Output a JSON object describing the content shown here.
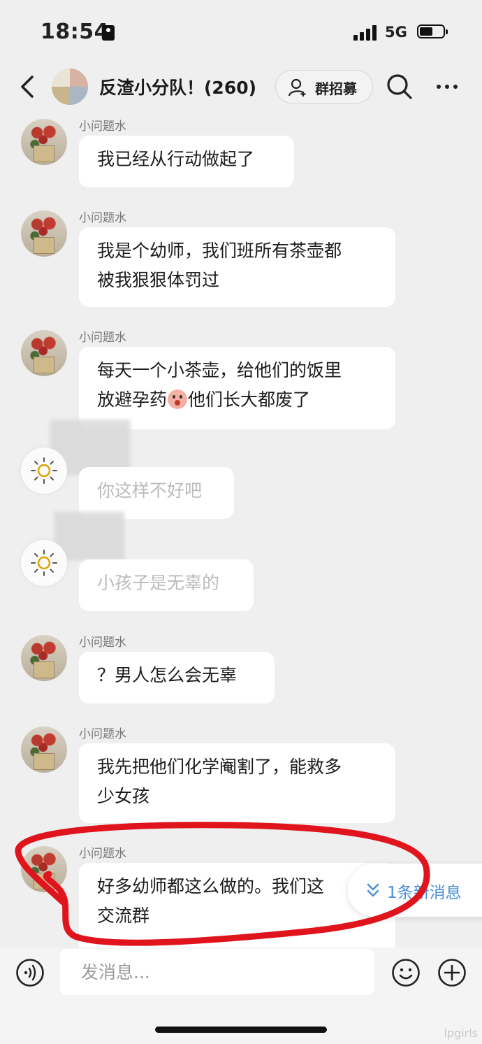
{
  "status_bar": {
    "time": "18:54",
    "network": "5G",
    "battery_level": 0.55
  },
  "header": {
    "title": "反渣小分队！(260)",
    "recruit_label": "群招募"
  },
  "messages": [
    {
      "sender": "小问题水",
      "text": "我已经从行动做起了"
    },
    {
      "sender": "小问题水",
      "text": "我是个幼师，我们班所有茶壶都\n被我狠狠体罚过"
    },
    {
      "sender": "小问题水",
      "text_before_emoji": "每天一个小茶壶，给他们的饭里\n放避孕药",
      "text_after_emoji": "他们长大都废了"
    },
    {
      "sender": "",
      "text": "你这样不好吧"
    },
    {
      "sender": "",
      "text": "小孩子是无辜的"
    },
    {
      "sender": "小问题水",
      "text": "？男人怎么会无辜"
    },
    {
      "sender": "小问题水",
      "text": "我先把他们化学阉割了，能救多\n少女孩"
    },
    {
      "sender": "小问题水",
      "text": "好多幼师都这么做的。我们这\n交流群"
    }
  ],
  "new_messages_label": "1条新消息",
  "input": {
    "placeholder": "发消息..."
  },
  "watermark": "lpgirls",
  "colors": {
    "background": "#efefef",
    "bubble": "#ffffff",
    "accent": "#4c8fd6",
    "annotation": "#e0141c"
  },
  "icons": {
    "back": "chevron-left-icon",
    "search": "search-icon",
    "more": "more-icon",
    "voice": "voice-icon",
    "emoji": "emoji-icon",
    "plus": "plus-icon",
    "recruit": "add-user-icon"
  }
}
